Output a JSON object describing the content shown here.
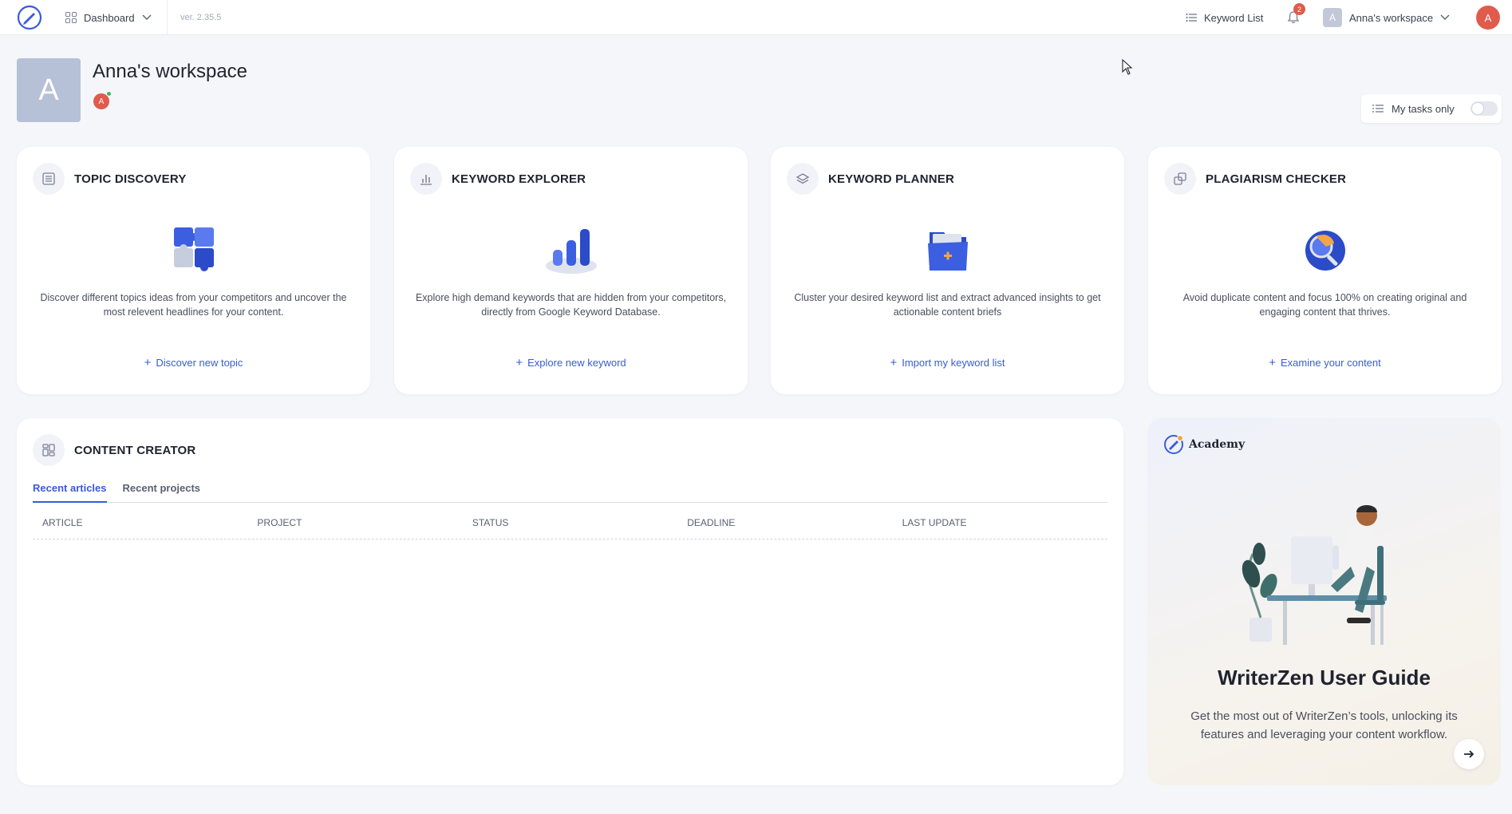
{
  "topbar": {
    "nav_label": "Dashboard",
    "version": "ver. 2.35.5",
    "keyword_list_label": "Keyword List",
    "notification_count": "2",
    "workspace_initial": "A",
    "workspace_label": "Anna's workspace",
    "user_initial": "A"
  },
  "workspace": {
    "initial": "A",
    "title": "Anna's workspace",
    "member_initial": "A",
    "my_tasks_label": "My tasks only",
    "my_tasks_enabled": false
  },
  "tools": [
    {
      "title": "TOPIC DISCOVERY",
      "icon": "list-icon",
      "illustration": "puzzle-illustration",
      "description": "Discover different topics ideas from your competitors and uncover the most relevent headlines for your content.",
      "action": "Discover new topic"
    },
    {
      "title": "KEYWORD EXPLORER",
      "icon": "bar-chart-icon",
      "illustration": "bar-chart-illustration",
      "description": "Explore high demand keywords that are hidden from your competitors, directly from Google Keyword Database.",
      "action": "Explore new keyword"
    },
    {
      "title": "KEYWORD PLANNER",
      "icon": "layers-icon",
      "illustration": "folder-illustration",
      "description": "Cluster your desired keyword list and extract advanced insights to get actionable content briefs",
      "action": "Import my keyword list"
    },
    {
      "title": "PLAGIARISM CHECKER",
      "icon": "copy-icon",
      "illustration": "magnifier-illustration",
      "description": "Avoid duplicate content and focus 100% on creating original and engaging content that thrives.",
      "action": "Examine your content"
    }
  ],
  "content_creator": {
    "title": "CONTENT CREATOR",
    "tabs": [
      "Recent articles",
      "Recent projects"
    ],
    "active_tab": "Recent articles",
    "columns": [
      "ARTICLE",
      "PROJECT",
      "STATUS",
      "DEADLINE",
      "LAST UPDATE"
    ],
    "rows": []
  },
  "academy": {
    "brand": "Academy",
    "title": "WriterZen User Guide",
    "description": "Get the most out of WriterZen’s tools, unlocking its features and leveraging your content workflow."
  },
  "colors": {
    "accent": "#3a5bd9",
    "avatar_red": "#e05b4b",
    "workspace_avatar": "#b6c0d6",
    "page_bg": "#f5f6fa"
  }
}
